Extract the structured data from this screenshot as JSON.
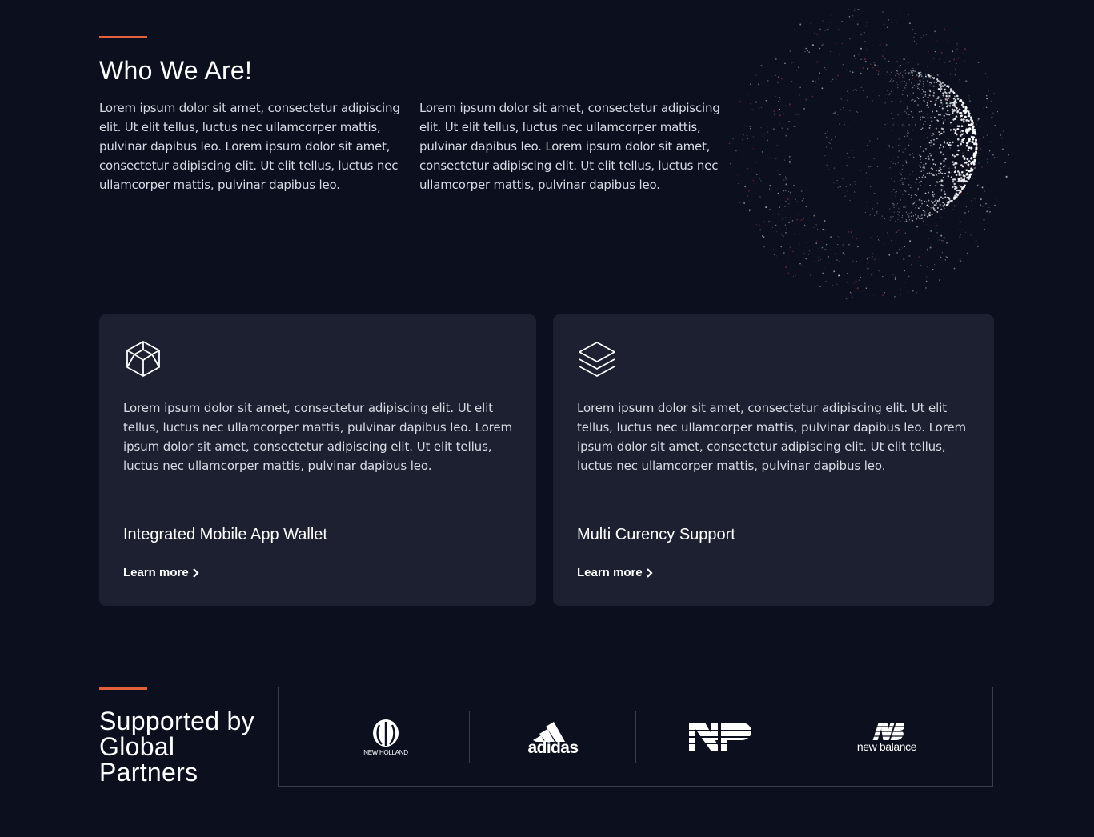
{
  "who": {
    "title": "Who We Are!",
    "paragraph_left": "Lorem ipsum dolor sit amet, consectetur adipiscing elit. Ut elit tellus, luctus nec ullamcorper mattis, pulvinar dapibus leo. Lorem ipsum dolor sit amet, consectetur adipiscing elit. Ut elit tellus, luctus nec ullamcorper mattis, pulvinar dapibus leo.",
    "paragraph_right": "Lorem ipsum dolor sit amet, consectetur adipiscing elit. Ut elit tellus, luctus nec ullamcorper mattis, pulvinar dapibus leo. Lorem ipsum dolor sit amet, consectetur adipiscing elit. Ut elit tellus, luctus nec ullamcorper mattis, pulvinar dapibus leo."
  },
  "features": [
    {
      "icon": "cube-icon",
      "text": "Lorem ipsum dolor sit amet, consectetur adipiscing elit. Ut elit tellus, luctus nec ullamcorper mattis, pulvinar dapibus leo. Lorem ipsum dolor sit amet, consectetur adipiscing elit. Ut elit tellus, luctus nec ullamcorper mattis, pulvinar dapibus leo.",
      "title": "Integrated Mobile App Wallet",
      "link": "Learn more"
    },
    {
      "icon": "layers-icon",
      "text": "Lorem ipsum dolor sit amet, consectetur adipiscing elit. Ut elit tellus, luctus nec ullamcorper mattis, pulvinar dapibus leo. Lorem ipsum dolor sit amet, consectetur adipiscing elit. Ut elit tellus, luctus nec ullamcorper mattis, pulvinar dapibus leo.",
      "title": "Multi Curency Support",
      "link": "Learn more"
    }
  ],
  "partners": {
    "title": "Supported by Global Partners",
    "logos": [
      {
        "name": "new-holland-logo",
        "wordmark": "NEW HOLLAND"
      },
      {
        "name": "adidas-logo",
        "wordmark": "adidas"
      },
      {
        "name": "np-logo",
        "wordmark": "NP"
      },
      {
        "name": "new-balance-logo",
        "wordmark": "new balance"
      }
    ]
  },
  "colors": {
    "background": "#0b0f1e",
    "card": "#1c2030",
    "accent": "#e2603b",
    "text": "#ffffff"
  }
}
